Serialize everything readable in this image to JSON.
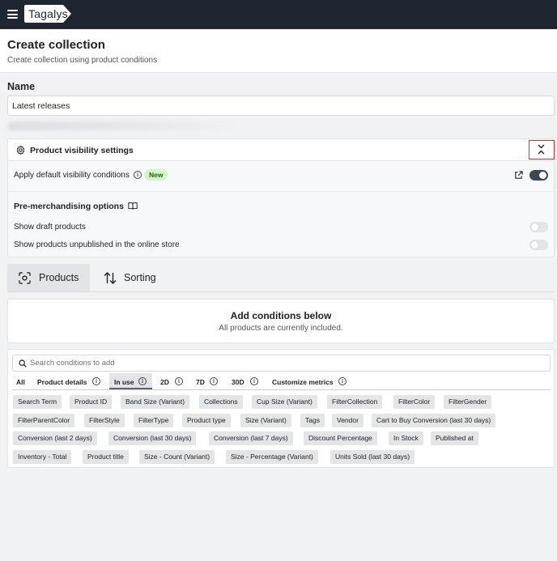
{
  "app": {
    "logo": "Tagalys"
  },
  "header": {
    "title": "Create collection",
    "subtitle": "Create collection using product conditions"
  },
  "name_field": {
    "label": "Name",
    "value": "Latest releases"
  },
  "visibility": {
    "title": "Product visibility settings",
    "apply_label": "Apply default visibility conditions",
    "apply_badge": "New",
    "apply_enabled": true,
    "premerch_title": "Pre-merchandising options",
    "options": [
      {
        "label": "Show draft products",
        "enabled": false
      },
      {
        "label": "Show products unpublished in the online store",
        "enabled": false
      }
    ]
  },
  "tabs": [
    {
      "label": "Products",
      "active": true
    },
    {
      "label": "Sorting",
      "active": false
    }
  ],
  "conditions": {
    "title": "Add conditions below",
    "subtitle": "All products are currently included."
  },
  "search": {
    "placeholder": "Search conditions to add"
  },
  "filter_tabs": [
    {
      "label": "All",
      "info": false,
      "active": false
    },
    {
      "label": "Product details",
      "info": true,
      "active": false
    },
    {
      "label": "In use",
      "info": true,
      "active": true
    },
    {
      "label": "2D",
      "info": true,
      "active": false
    },
    {
      "label": "7D",
      "info": true,
      "active": false
    },
    {
      "label": "30D",
      "info": true,
      "active": false
    },
    {
      "label": "Customize metrics",
      "info": true,
      "active": false
    }
  ],
  "chips": [
    [
      "Search Term",
      "Product ID",
      "Band Size (Variant)",
      "Collections",
      "Cup Size (Variant)",
      "FilterCollection",
      "FilterColor",
      "FilterGender"
    ],
    [
      "FilterParentColor",
      "FilterStyle",
      "FilterType",
      "Product type",
      "Size (Variant)",
      "Tags",
      "Vendor",
      "Cart to Buy Conversion (last 30 days)"
    ],
    [
      "Conversion (last 2 days)",
      "Conversion (last 30 days)",
      "Conversion (last 7 days)",
      "Discount Percentage",
      "In Stock",
      "Published at"
    ],
    [
      "Inventory - Total",
      "Product title",
      "Size - Count (Variant)",
      "Size - Percentage (Variant)",
      "Units Sold (last 30 days)"
    ]
  ],
  "colors": {
    "topbar": "#1f2631",
    "accent_red": "#d72c2c",
    "badge_green": "#d4f5c7",
    "toggle_on": "#3d4651"
  }
}
